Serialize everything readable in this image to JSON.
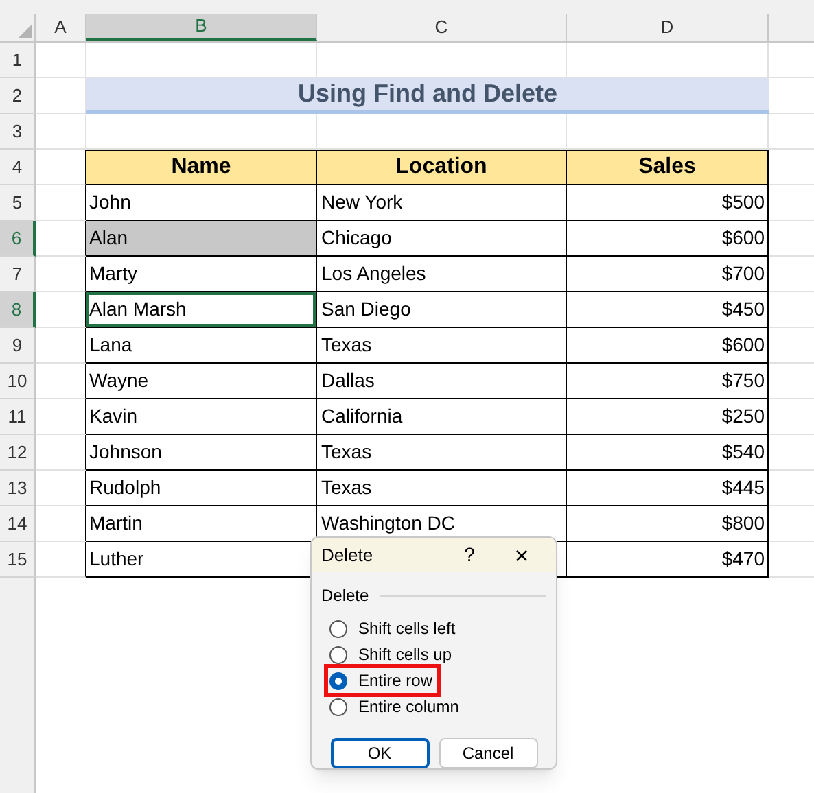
{
  "column_headers": [
    {
      "label": "A",
      "selected": false
    },
    {
      "label": "B",
      "selected": true
    },
    {
      "label": "C",
      "selected": false
    },
    {
      "label": "D",
      "selected": false
    }
  ],
  "row_headers": [
    {
      "label": "1",
      "selected": false
    },
    {
      "label": "2",
      "selected": false
    },
    {
      "label": "3",
      "selected": false
    },
    {
      "label": "4",
      "selected": false
    },
    {
      "label": "5",
      "selected": false
    },
    {
      "label": "6",
      "selected": true
    },
    {
      "label": "7",
      "selected": false
    },
    {
      "label": "8",
      "selected": true
    },
    {
      "label": "9",
      "selected": false
    },
    {
      "label": "10",
      "selected": false
    },
    {
      "label": "11",
      "selected": false
    },
    {
      "label": "12",
      "selected": false
    },
    {
      "label": "13",
      "selected": false
    },
    {
      "label": "14",
      "selected": false
    },
    {
      "label": "15",
      "selected": false
    }
  ],
  "title": "Using Find and Delete",
  "table": {
    "columns": [
      "Name",
      "Location",
      "Sales"
    ],
    "rows": [
      {
        "name": "John",
        "location": "New York",
        "sales": "$500",
        "highlighted": false,
        "active": false
      },
      {
        "name": "Alan",
        "location": "Chicago",
        "sales": "$600",
        "highlighted": true,
        "active": false
      },
      {
        "name": "Marty",
        "location": "Los Angeles",
        "sales": "$700",
        "highlighted": false,
        "active": false
      },
      {
        "name": "Alan Marsh",
        "location": "San Diego",
        "sales": "$450",
        "highlighted": false,
        "active": true
      },
      {
        "name": "Lana",
        "location": "Texas",
        "sales": "$600",
        "highlighted": false,
        "active": false
      },
      {
        "name": "Wayne",
        "location": "Dallas",
        "sales": "$750",
        "highlighted": false,
        "active": false
      },
      {
        "name": "Kavin",
        "location": "California",
        "sales": "$250",
        "highlighted": false,
        "active": false
      },
      {
        "name": "Johnson",
        "location": "Texas",
        "sales": "$540",
        "highlighted": false,
        "active": false
      },
      {
        "name": "Rudolph",
        "location": "Texas",
        "sales": "$445",
        "highlighted": false,
        "active": false
      },
      {
        "name": "Martin",
        "location": "Washington DC",
        "sales": "$800",
        "highlighted": false,
        "active": false
      },
      {
        "name": "Luther",
        "sales": "$470",
        "highlighted": false,
        "active": false
      }
    ]
  },
  "dialog": {
    "title": "Delete",
    "help": "?",
    "close": "×",
    "group_label": "Delete",
    "options": [
      {
        "label": "Shift cells left",
        "selected": false,
        "highlighted": false
      },
      {
        "label": "Shift cells up",
        "selected": false,
        "highlighted": false
      },
      {
        "label": "Entire row",
        "selected": true,
        "highlighted": true
      },
      {
        "label": "Entire column",
        "selected": false,
        "highlighted": false
      }
    ],
    "buttons": [
      {
        "label": "OK",
        "default": true
      },
      {
        "label": "Cancel",
        "default": false
      }
    ]
  }
}
